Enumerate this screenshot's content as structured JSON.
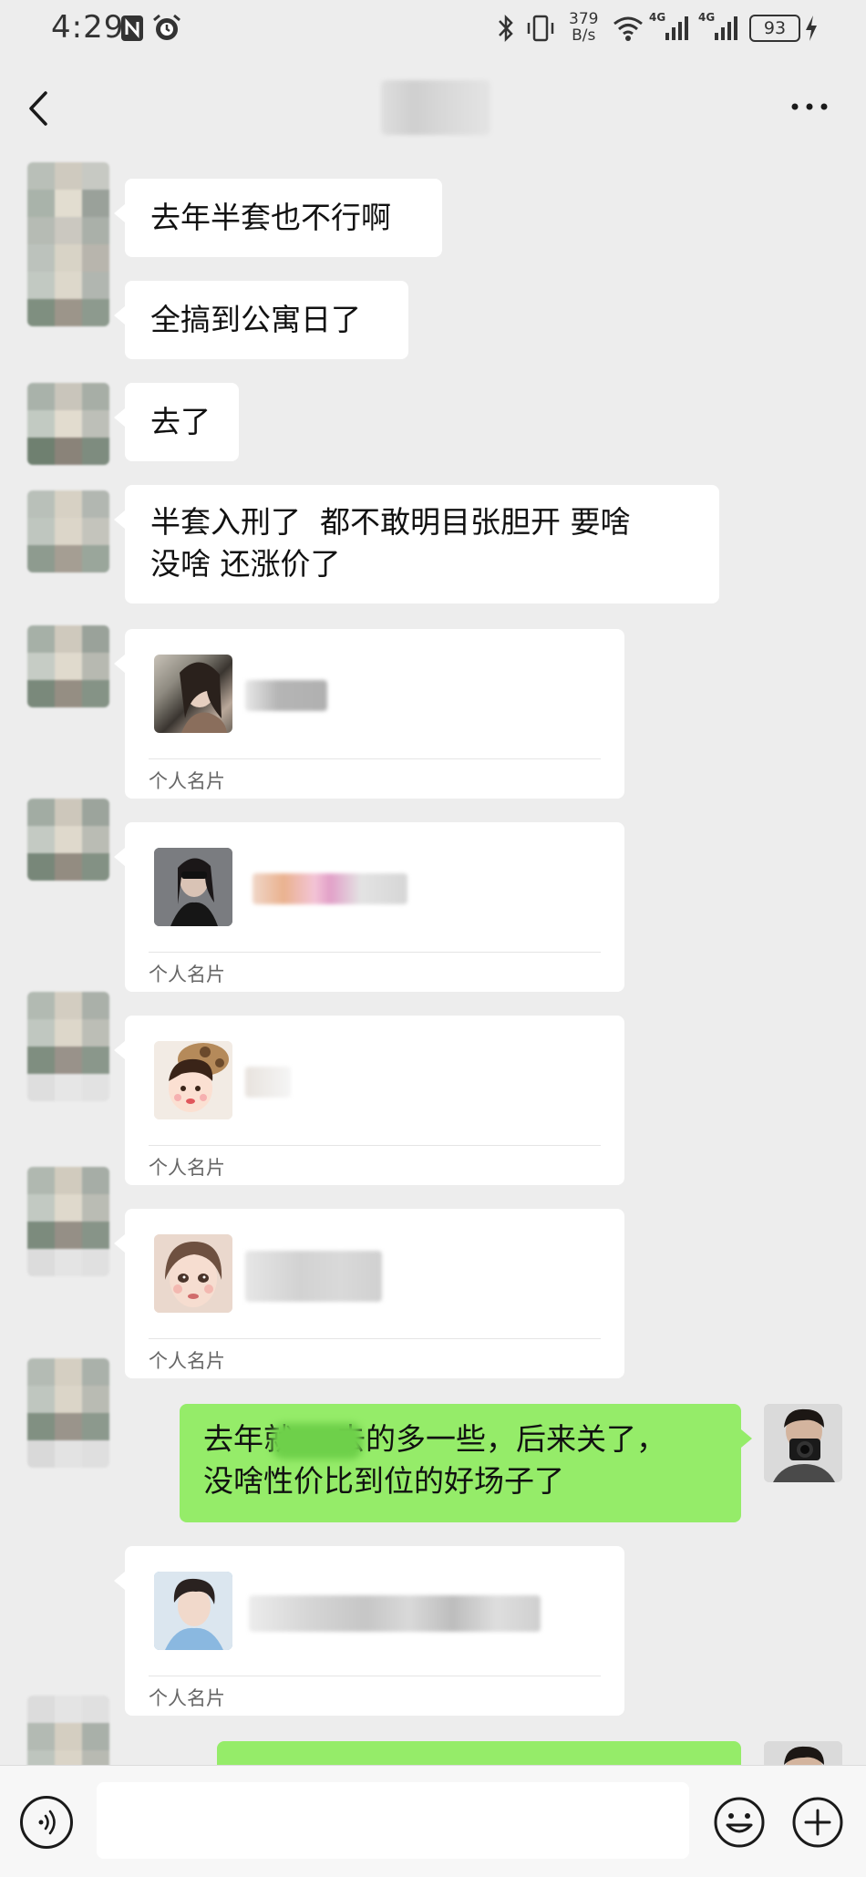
{
  "status_bar": {
    "time": "4:29",
    "net_speed_value": "379",
    "net_speed_unit": "B/s",
    "battery": "93",
    "signal_label_1": "4G",
    "signal_label_2": "4G"
  },
  "header": {
    "back_icon": "chevron-left-icon",
    "more_icon": "more-dots-icon"
  },
  "messages": [
    {
      "side": "left",
      "type": "text",
      "text": "去年半套也不行啊"
    },
    {
      "side": "left",
      "type": "text",
      "text": "全搞到公寓日了"
    },
    {
      "side": "left",
      "type": "text",
      "text": "去了"
    },
    {
      "side": "left",
      "type": "text",
      "line1": "半套入刑了  都不敢明目张胆开 要啥",
      "line2": "没啥 还涨价了"
    },
    {
      "side": "left",
      "type": "card",
      "label": "个人名片"
    },
    {
      "side": "left",
      "type": "card",
      "label": "个人名片"
    },
    {
      "side": "left",
      "type": "card",
      "label": "个人名片"
    },
    {
      "side": "left",
      "type": "card",
      "label": "个人名片"
    },
    {
      "side": "right",
      "type": "text",
      "line1_a": "去年就",
      "line1_b": "去的多一些，后来关了，",
      "line2": "没啥性价比到位的好场子了"
    },
    {
      "side": "left",
      "type": "card",
      "label": "个人名片"
    },
    {
      "side": "right",
      "type": "text"
    }
  ],
  "input_bar": {
    "voice_icon": "voice-icon",
    "input_value": "",
    "emoji_icon": "emoji-icon",
    "plus_icon": "plus-icon"
  }
}
